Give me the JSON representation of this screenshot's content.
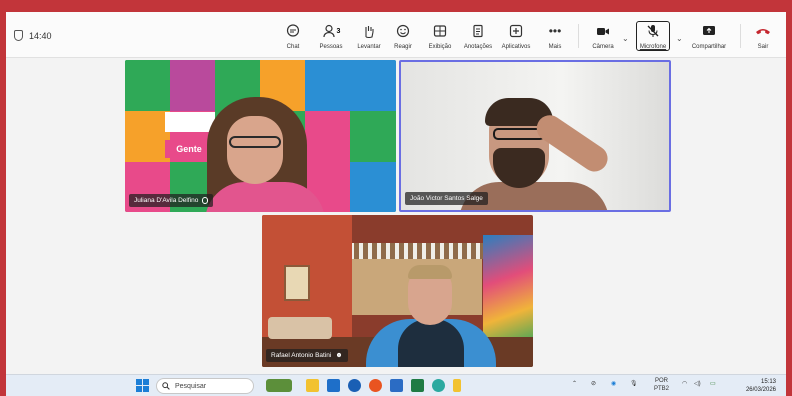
{
  "timer": "14:40",
  "toolbar": {
    "chat": "Chat",
    "people": "Pessoas",
    "people_count": "3",
    "raise": "Levantar",
    "react": "Reagir",
    "view": "Exibição",
    "notes": "Anotações",
    "apps": "Aplicativos",
    "more": "Mais",
    "camera": "Câmera",
    "mic": "Microfone",
    "share": "Compartilhar",
    "leave": "Sair"
  },
  "participants": [
    {
      "name": "Juliana D'Avila Delfino"
    },
    {
      "name": "João Victor Santos Salge"
    },
    {
      "name": "Rafael Antonio Batini"
    }
  ],
  "tile1_sign": "Gente",
  "taskbar": {
    "search_placeholder": "Pesquisar",
    "lang": "POR",
    "lang_sub": "PTB2",
    "time": "15:13",
    "date": "26/03/2026"
  },
  "colors": {
    "frame_border": "#c2353a",
    "active_speaker": "#6a6ee3",
    "leave": "#c4262e"
  }
}
